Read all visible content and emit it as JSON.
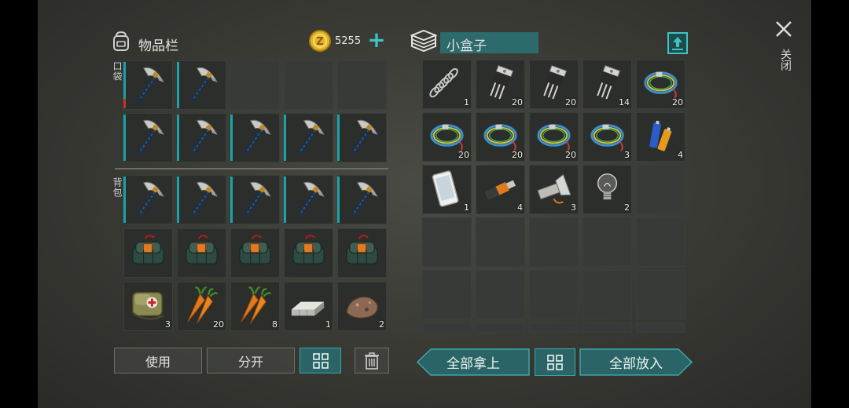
{
  "inventory": {
    "title": "物品栏",
    "coins": "5255",
    "pocket_label": "口袋",
    "backpack_label": "背包",
    "slots": [
      {
        "item": "pickaxe-icon",
        "count": "",
        "dur": true,
        "red": true
      },
      {
        "item": "pickaxe-icon",
        "count": "",
        "dur": true
      },
      {
        "item": "",
        "count": ""
      },
      {
        "item": "",
        "count": ""
      },
      {
        "item": "",
        "count": ""
      },
      {
        "item": "pickaxe-icon",
        "count": "",
        "dur": true
      },
      {
        "item": "pickaxe-icon",
        "count": "",
        "dur": true
      },
      {
        "item": "pickaxe-icon",
        "count": "",
        "dur": true
      },
      {
        "item": "pickaxe-icon",
        "count": "",
        "dur": true
      },
      {
        "item": "pickaxe-icon",
        "count": "",
        "dur": true
      },
      {
        "item": "pickaxe-icon",
        "count": "",
        "dur": true
      },
      {
        "item": "pickaxe-icon",
        "count": "",
        "dur": true
      },
      {
        "item": "pickaxe-icon",
        "count": "",
        "dur": true
      },
      {
        "item": "pickaxe-icon",
        "count": "",
        "dur": true
      },
      {
        "item": "pickaxe-icon",
        "count": "",
        "dur": true
      },
      {
        "item": "explosive-pack-icon",
        "count": ""
      },
      {
        "item": "explosive-pack-icon",
        "count": ""
      },
      {
        "item": "explosive-pack-icon",
        "count": ""
      },
      {
        "item": "explosive-pack-icon",
        "count": ""
      },
      {
        "item": "explosive-pack-icon",
        "count": ""
      },
      {
        "item": "medkit-bag-icon",
        "count": "3"
      },
      {
        "item": "carrot-icon",
        "count": "20"
      },
      {
        "item": "carrot-icon",
        "count": "8"
      },
      {
        "item": "metal-ingot-icon",
        "count": "1"
      },
      {
        "item": "ore-rock-icon",
        "count": "2"
      }
    ],
    "buttons": {
      "use": "使用",
      "split": "分开"
    }
  },
  "box": {
    "title": "小盒子",
    "slots": [
      {
        "item": "spring-icon",
        "count": "1"
      },
      {
        "item": "transistor-icon",
        "count": "20"
      },
      {
        "item": "transistor-icon",
        "count": "20"
      },
      {
        "item": "transistor-icon",
        "count": "14"
      },
      {
        "item": "wire-coil-icon",
        "count": "20"
      },
      {
        "item": "wire-coil-icon",
        "count": "20"
      },
      {
        "item": "wire-coil-icon",
        "count": "20"
      },
      {
        "item": "wire-coil-icon",
        "count": "20"
      },
      {
        "item": "wire-coil-icon",
        "count": "3"
      },
      {
        "item": "batteries-icon",
        "count": "4"
      },
      {
        "item": "smartphone-icon",
        "count": "1"
      },
      {
        "item": "usb-drive-icon",
        "count": "4"
      },
      {
        "item": "flashlight-icon",
        "count": "3"
      },
      {
        "item": "light-bulb-icon",
        "count": "2"
      },
      {
        "item": "",
        "count": ""
      },
      {
        "item": "",
        "count": ""
      },
      {
        "item": "",
        "count": ""
      },
      {
        "item": "",
        "count": ""
      },
      {
        "item": "",
        "count": ""
      },
      {
        "item": "",
        "count": ""
      },
      {
        "item": "",
        "count": ""
      },
      {
        "item": "",
        "count": ""
      },
      {
        "item": "",
        "count": ""
      },
      {
        "item": "",
        "count": ""
      },
      {
        "item": "",
        "count": ""
      },
      {
        "item": "",
        "count": ""
      },
      {
        "item": "",
        "count": ""
      },
      {
        "item": "",
        "count": ""
      },
      {
        "item": "",
        "count": ""
      },
      {
        "item": "",
        "count": ""
      }
    ],
    "buttons": {
      "take_all": "全部拿上",
      "put_all": "全部放入"
    }
  },
  "close_label": "关闭",
  "colors": {
    "accent": "#2a6466",
    "durability": "#1aa3a8",
    "coin": "#e2b52a"
  }
}
